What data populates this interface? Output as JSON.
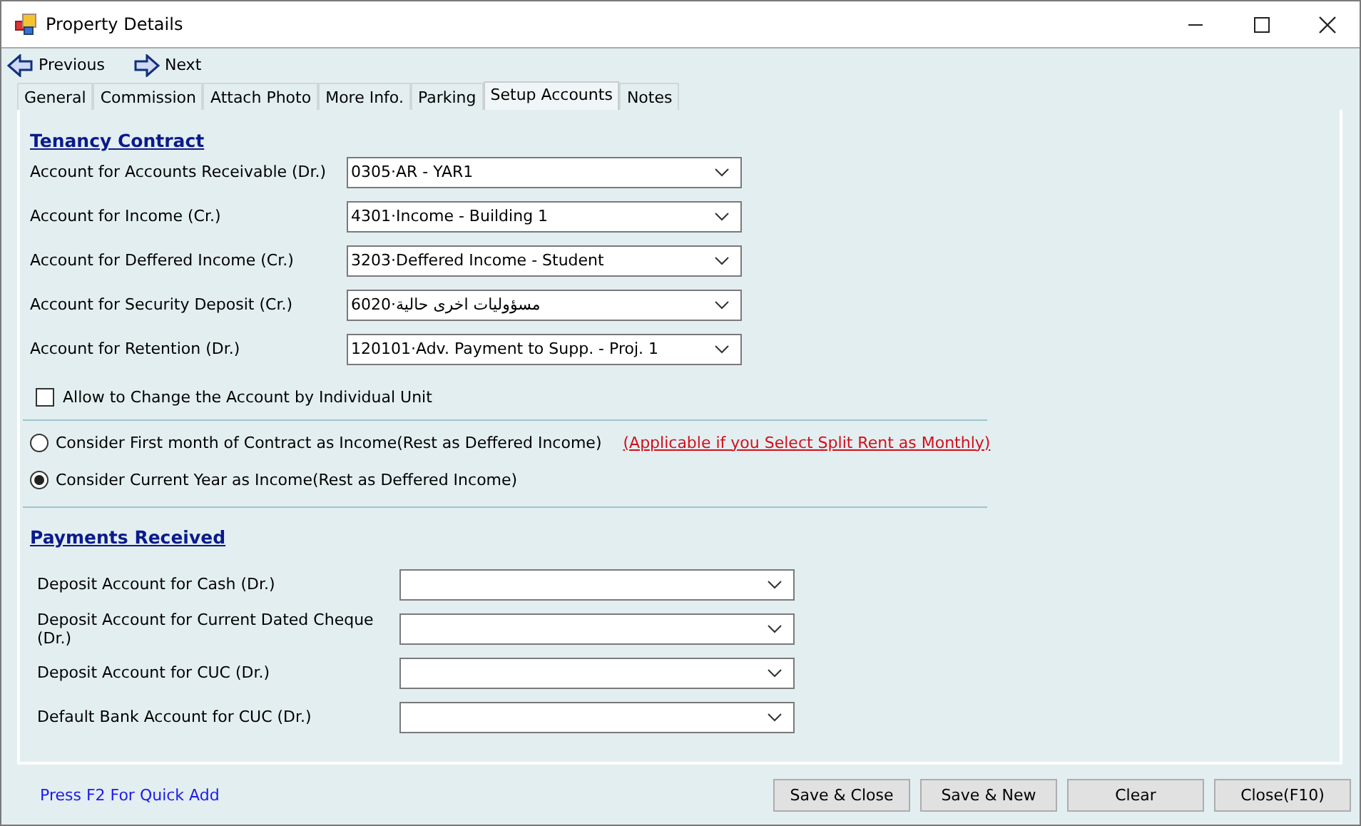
{
  "window": {
    "title": "Property Details"
  },
  "nav": [
    {
      "label": "Previous",
      "kind": "previous"
    },
    {
      "label": "Next",
      "kind": "next"
    }
  ],
  "tabs": [
    {
      "label": "General",
      "selected": false
    },
    {
      "label": "Commission",
      "selected": false
    },
    {
      "label": "Attach Photo",
      "selected": false
    },
    {
      "label": "More Info.",
      "selected": false
    },
    {
      "label": "Parking",
      "selected": false
    },
    {
      "label": "Setup Accounts",
      "selected": true
    },
    {
      "label": "Notes",
      "selected": false
    }
  ],
  "tenancy": {
    "heading": "Tenancy Contract",
    "accounts": [
      {
        "label": "Account for Accounts Receivable (Dr.)",
        "value": "0305·AR - YAR1"
      },
      {
        "label": "Account for Income (Cr.)",
        "value": "4301·Income - Building 1"
      },
      {
        "label": "Account for Deffered Income (Cr.)",
        "value": "3203·Deffered Income - Student"
      },
      {
        "label": "Account for Security Deposit (Cr.)",
        "value": "6020·مسؤوليات اخرى حالية"
      },
      {
        "label": "Account for Retention (Dr.)",
        "value": "120101·Adv. Payment to Supp. - Proj. 1"
      }
    ],
    "allow_change": {
      "label": "Allow to Change the Account by Individual Unit",
      "checked": false
    },
    "income_options": [
      {
        "label": "Consider First month of Contract as Income(Rest as Deffered Income)",
        "selected": false,
        "note": "(Applicable if you Select Split Rent as Monthly)"
      },
      {
        "label": "Consider Current Year as Income(Rest as Deffered Income)",
        "selected": true
      }
    ]
  },
  "payments": {
    "heading": "Payments Received",
    "accounts": [
      {
        "label": "Deposit Account for Cash (Dr.)"
      },
      {
        "label": "Deposit Account for Current Dated Cheque (Dr.)"
      },
      {
        "label": "Deposit Account for CUC (Dr.)"
      },
      {
        "label": "Default Bank Account for CUC (Dr.)"
      }
    ]
  },
  "footer": {
    "hint": "Press F2 For Quick Add",
    "buttons": [
      "Save & Close",
      "Save & New",
      "Clear",
      "Close(F10)"
    ]
  }
}
